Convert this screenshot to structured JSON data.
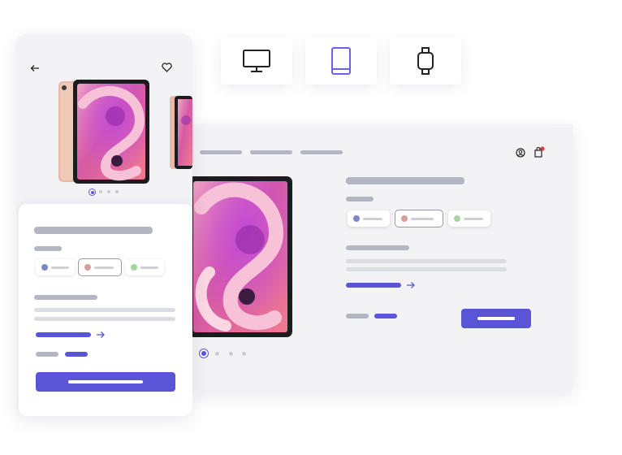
{
  "device_selector": {
    "options": [
      {
        "name": "desktop",
        "icon": "monitor-icon",
        "active": false
      },
      {
        "name": "tablet",
        "icon": "tablet-icon",
        "active": true
      },
      {
        "name": "watch",
        "icon": "watch-icon",
        "active": false
      }
    ],
    "active_color": "#6b63e0",
    "inactive_color": "#222222"
  },
  "desktop_view": {
    "nav_links": 3,
    "product_image": "tablet-with-abstract-pink-wallpaper",
    "color_options": [
      {
        "color": "#7c85c8",
        "selected": false
      },
      {
        "color": "#d79f9c",
        "selected": true
      },
      {
        "color": "#a6d39f",
        "selected": false
      }
    ],
    "carousel_pages": 4,
    "carousel_active_page": 1,
    "cart_badge_color": "#e23b3b"
  },
  "mobile_view": {
    "product_image": "tablet-with-abstract-pink-wallpaper",
    "color_options": [
      {
        "color": "#7c85c8",
        "selected": false
      },
      {
        "color": "#d79f9c",
        "selected": true
      },
      {
        "color": "#a6d39f",
        "selected": false
      }
    ],
    "carousel_pages": 4,
    "carousel_active_page": 1
  },
  "colors": {
    "accent": "#5a55d6",
    "skeleton": "#b4b6c2",
    "skeleton_light": "#dcdde3"
  }
}
